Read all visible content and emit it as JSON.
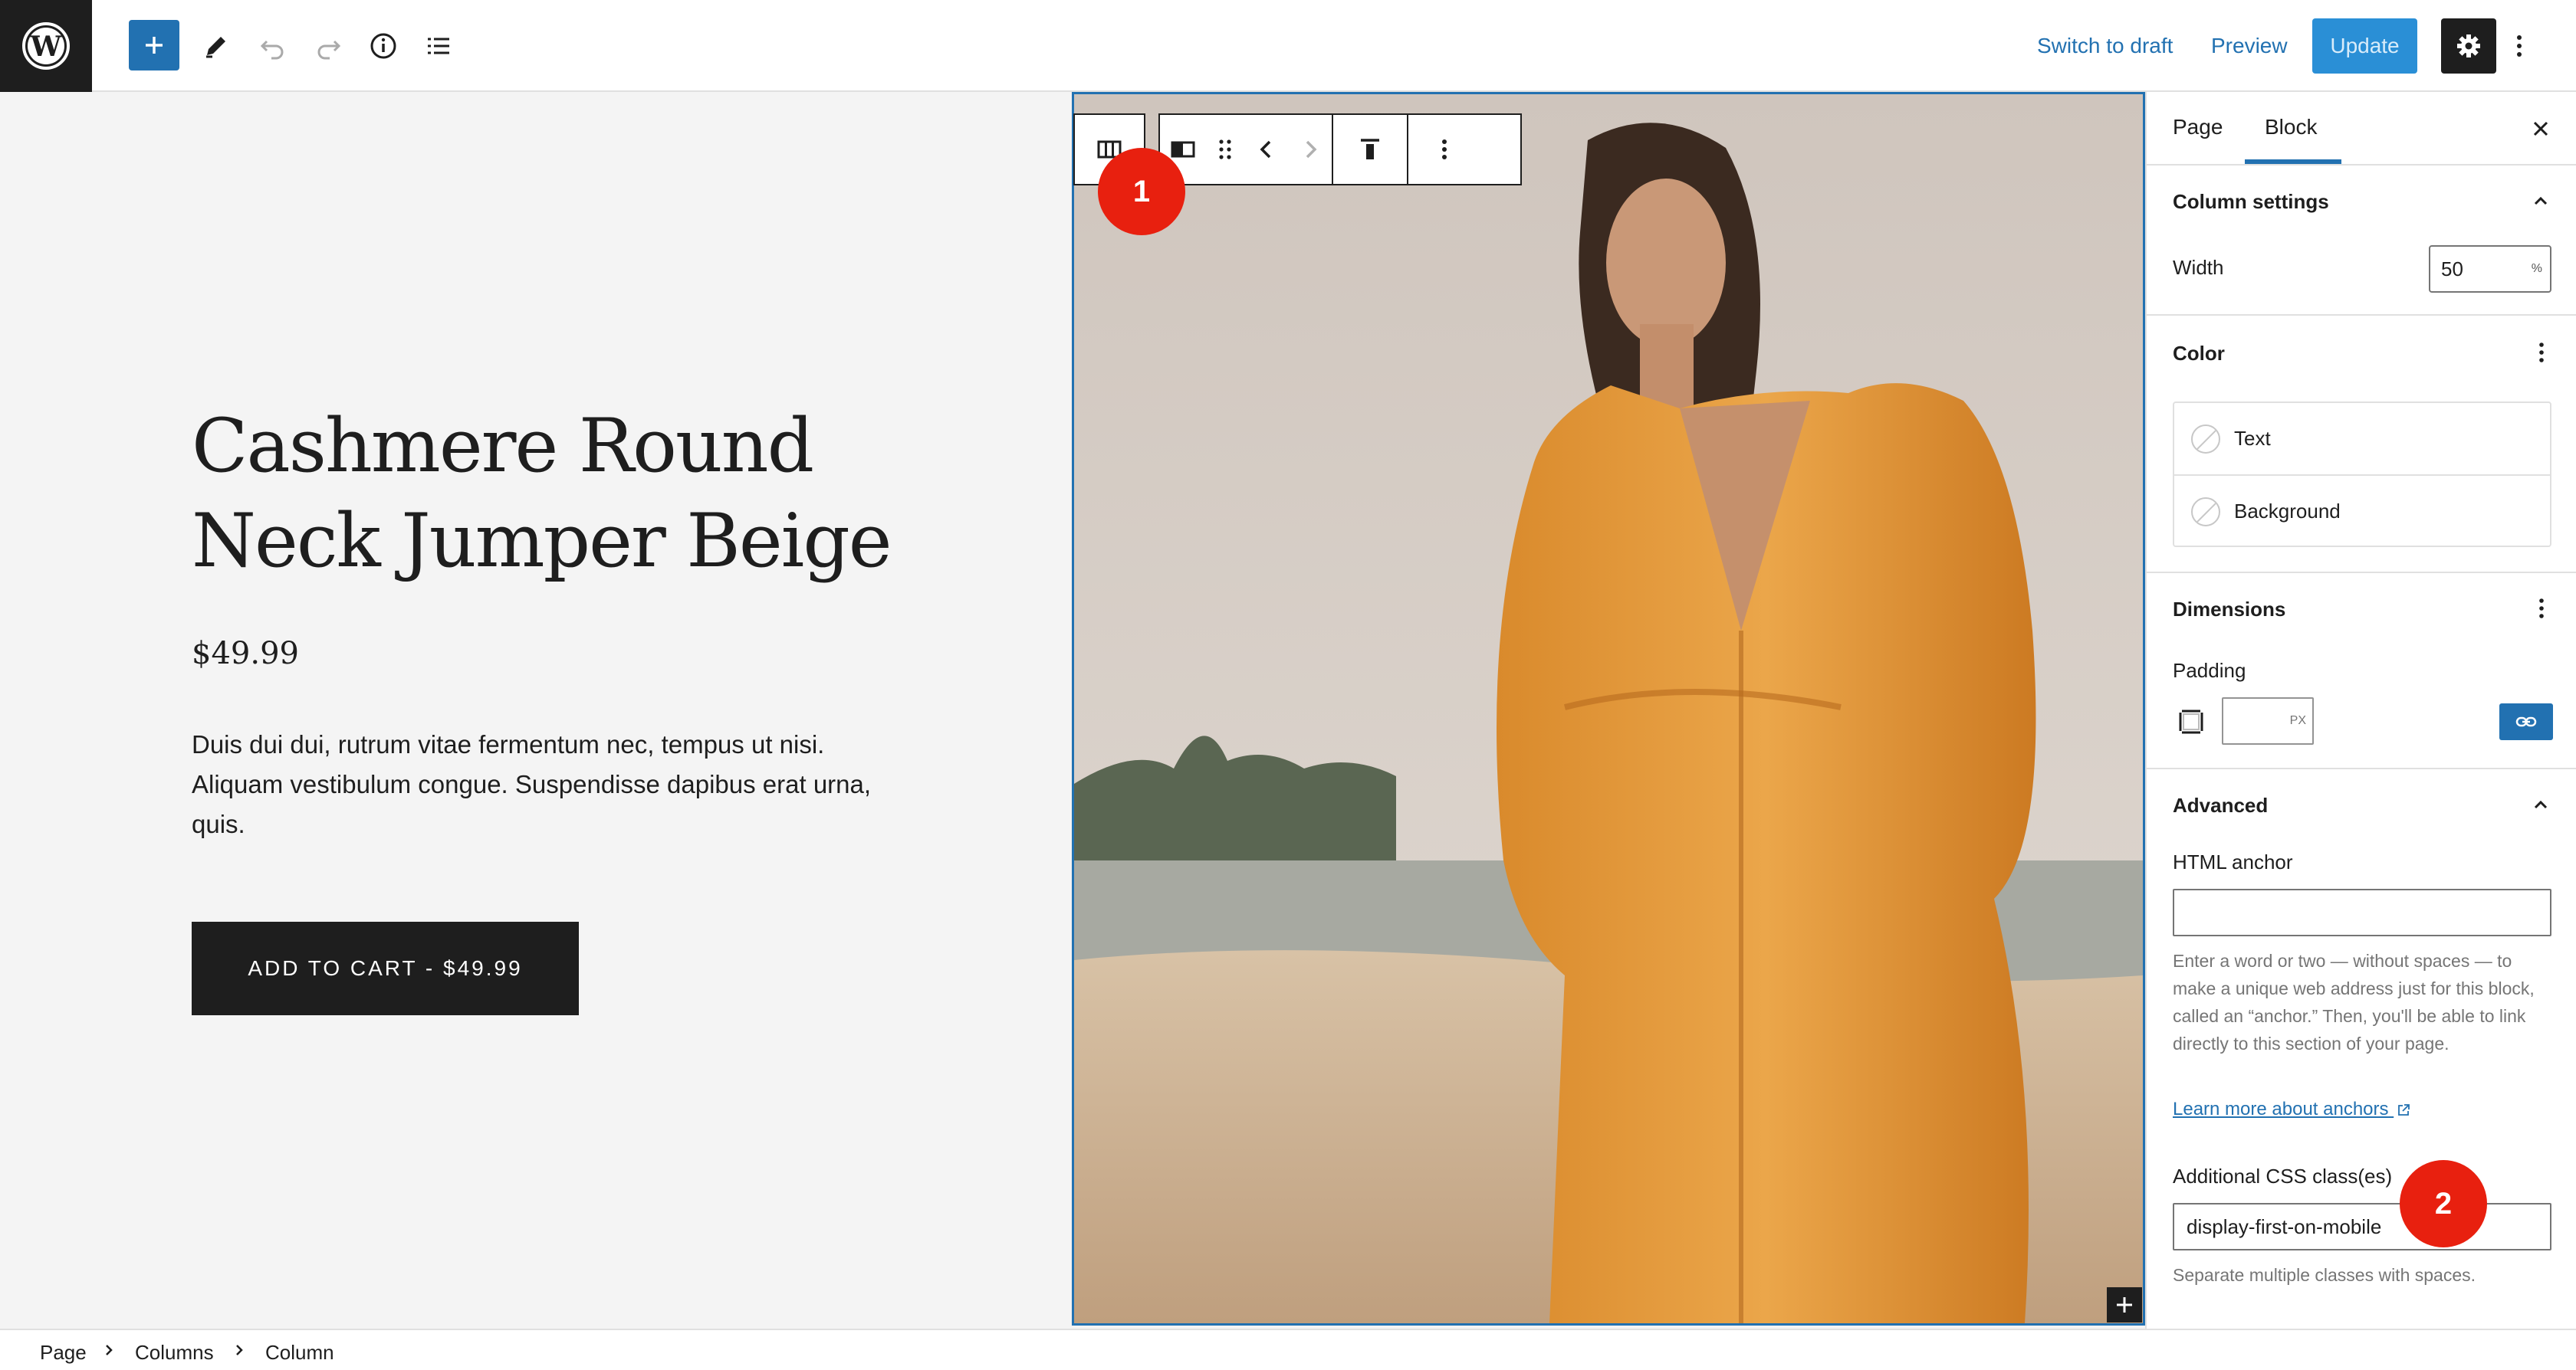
{
  "topbar": {
    "logo_icon": "wordpress-logo-icon",
    "add_icon": "plus-icon",
    "tools_icon": "pencil-icon",
    "undo_icon": "undo-icon",
    "redo_icon": "redo-icon",
    "details_icon": "info-icon",
    "list_view_icon": "list-view-icon",
    "switch_to_draft": "Switch to draft",
    "preview": "Preview",
    "update": "Update",
    "settings_icon": "gear-icon",
    "options_icon": "vertical-ellipsis-icon"
  },
  "canvas": {
    "title_line1": "Cashmere Round",
    "title_line2": "Neck Jumper Beige",
    "price": "$49.99",
    "description": "Duis dui dui, rutrum vitae fermentum nec, tempus ut nisi. Aliquam vestibulum congue. Suspendisse dapibus erat urna, quis.",
    "cart_button": "ADD TO  CART - $49.99",
    "image_alt": "Woman in an orange linen dress on a beach"
  },
  "block_toolbar": {
    "parent_icon": "columns-icon",
    "block_type_icon": "column-icon",
    "drag_icon": "drag-handle-icon",
    "move_left_icon": "chevron-left-icon",
    "move_right_icon": "chevron-right-icon",
    "align_icon": "align-top-icon",
    "more_icon": "vertical-ellipsis-icon"
  },
  "badges": {
    "first": "1",
    "second": "2"
  },
  "sidebar": {
    "tabs": [
      {
        "label": "Page"
      },
      {
        "label": "Block",
        "active": true
      }
    ],
    "close_icon": "close-icon",
    "column_settings": {
      "title": "Column settings",
      "width_label": "Width",
      "width_value": "50",
      "width_unit": "%"
    },
    "color": {
      "title": "Color",
      "text": "Text",
      "background": "Background"
    },
    "dimensions": {
      "title": "Dimensions",
      "padding_label": "Padding",
      "padding_unit": "PX"
    },
    "advanced": {
      "title": "Advanced",
      "html_anchor_label": "HTML anchor",
      "html_anchor_value": "",
      "anchor_help": "Enter a word or two — without spaces — to make a unique web address just for this block, called an “anchor.” Then, you'll be able to link directly to this section of your page.",
      "learn_more": "Learn more about anchors",
      "css_label": "Additional CSS class(es)",
      "css_value": "display-first-on-mobile",
      "css_help": "Separate multiple classes with spaces."
    }
  },
  "breadcrumb": [
    "Page",
    "Columns",
    "Column"
  ],
  "colors": {
    "accent": "#2271b1",
    "dark": "#1e1e1e",
    "badge": "#e8200f",
    "canvas_bg": "#f4f4f4"
  }
}
